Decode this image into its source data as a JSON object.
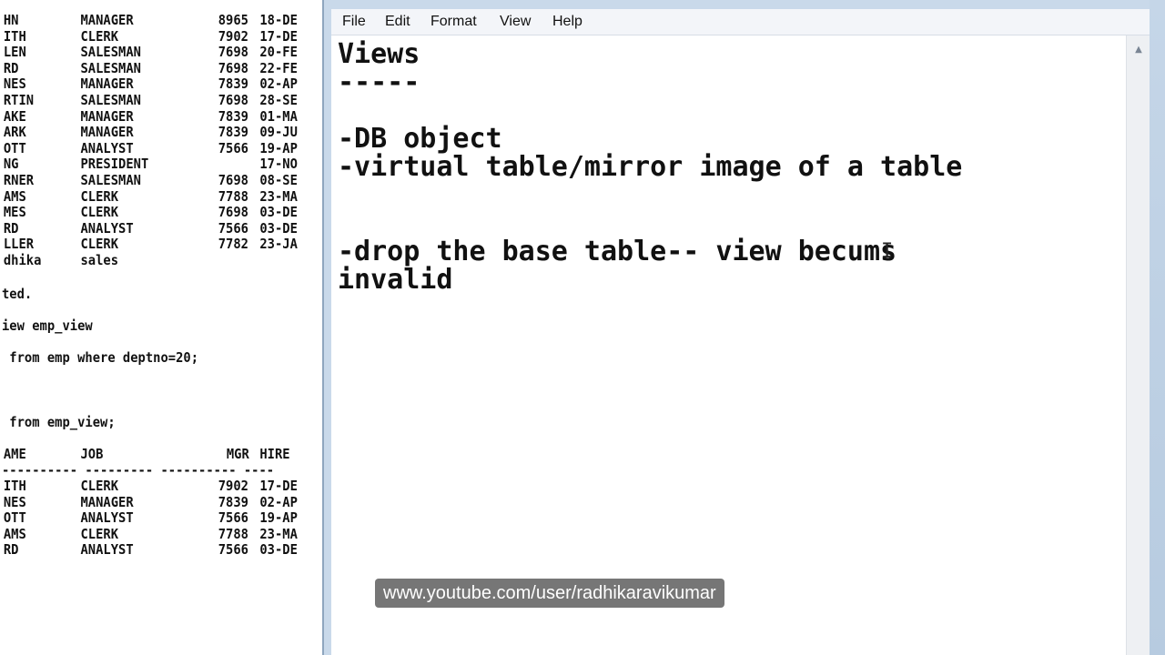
{
  "menu": {
    "items": [
      {
        "label": "File"
      },
      {
        "label": "Edit"
      },
      {
        "label": "Format"
      },
      {
        "label": "View"
      },
      {
        "label": "Help"
      }
    ]
  },
  "editor": {
    "lines": [
      "Views",
      "-----",
      "",
      "-DB object",
      "-virtual table/mirror image of a table",
      "",
      "",
      "-drop the base table-- view becums",
      "invalid"
    ]
  },
  "console": {
    "emp_rows": [
      [
        "HN",
        "MANAGER",
        "8965",
        "18-DE"
      ],
      [
        "ITH",
        "CLERK",
        "7902",
        "17-DE"
      ],
      [
        "LEN",
        "SALESMAN",
        "7698",
        "20-FE"
      ],
      [
        "RD",
        "SALESMAN",
        "7698",
        "22-FE"
      ],
      [
        "NES",
        "MANAGER",
        "7839",
        "02-AP"
      ],
      [
        "RTIN",
        "SALESMAN",
        "7698",
        "28-SE"
      ],
      [
        "AKE",
        "MANAGER",
        "7839",
        "01-MA"
      ],
      [
        "ARK",
        "MANAGER",
        "7839",
        "09-JU"
      ],
      [
        "OTT",
        "ANALYST",
        "7566",
        "19-AP"
      ],
      [
        "NG",
        "PRESIDENT",
        "",
        "17-NO"
      ],
      [
        "RNER",
        "SALESMAN",
        "7698",
        "08-SE"
      ],
      [
        "AMS",
        "CLERK",
        "7788",
        "23-MA"
      ],
      [
        "MES",
        "CLERK",
        "7698",
        "03-DE"
      ],
      [
        "RD",
        "ANALYST",
        "7566",
        "03-DE"
      ],
      [
        "LLER",
        "CLERK",
        "7782",
        "23-JA"
      ],
      [
        "dhika",
        "sales",
        "",
        ""
      ]
    ],
    "created_msg": "ted.",
    "create_view_cmd": "iew emp_view",
    "select_where_cmd": " from emp where deptno=20;",
    "select_view_cmd": " from emp_view;",
    "header_cols": [
      "AME",
      "JOB",
      "MGR",
      "HIRE"
    ],
    "separator": "---------- --------- ---------- ----",
    "view_rows": [
      [
        "ITH",
        "CLERK",
        "7902",
        "17-DE"
      ],
      [
        "NES",
        "MANAGER",
        "7839",
        "02-AP"
      ],
      [
        "OTT",
        "ANALYST",
        "7566",
        "19-AP"
      ],
      [
        "AMS",
        "CLERK",
        "7788",
        "23-MA"
      ],
      [
        "RD",
        "ANALYST",
        "7566",
        "03-DE"
      ]
    ]
  },
  "watermark": {
    "text": "www.youtube.com/user/radhikaravikumar"
  }
}
